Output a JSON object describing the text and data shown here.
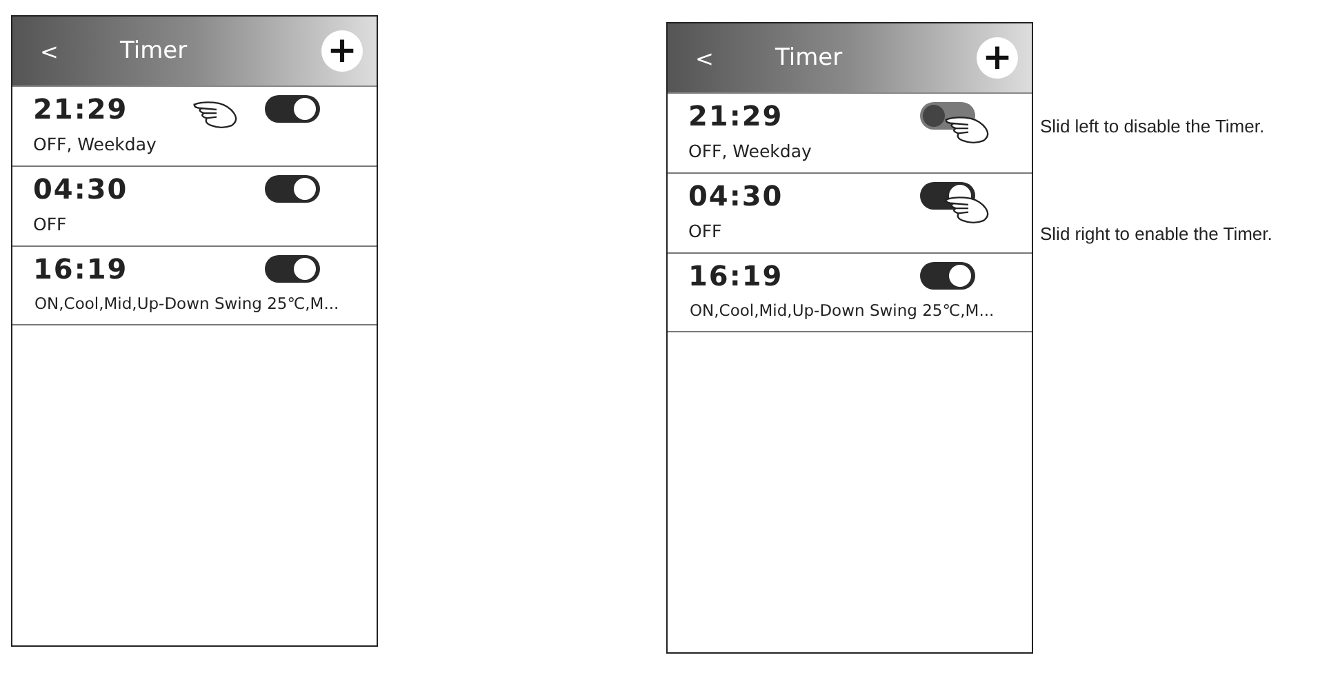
{
  "screens": [
    {
      "header": {
        "back": "<",
        "title": "Timer",
        "add": "+"
      },
      "timers": [
        {
          "time": "21:29",
          "detail": "OFF, Weekday",
          "on": true,
          "hand_beside": true
        },
        {
          "time": "04:30",
          "detail": "OFF",
          "on": true
        },
        {
          "time": "16:19",
          "detail": "ON,Cool,Mid,Up-Down Swing 25℃,M...",
          "on": true
        }
      ]
    },
    {
      "header": {
        "back": "<",
        "title": "Timer",
        "add": "+"
      },
      "timers": [
        {
          "time": "21:29",
          "detail": "OFF, Weekday",
          "on": false,
          "hand_on_toggle": true
        },
        {
          "time": "04:30",
          "detail": "OFF",
          "on": true,
          "hand_on_toggle": true
        },
        {
          "time": "16:19",
          "detail": "ON,Cool,Mid,Up-Down Swing 25℃,M...",
          "on": true
        }
      ]
    }
  ],
  "notes": [
    "Slid left to disable the Timer.",
    "Slid right to enable the Timer."
  ]
}
